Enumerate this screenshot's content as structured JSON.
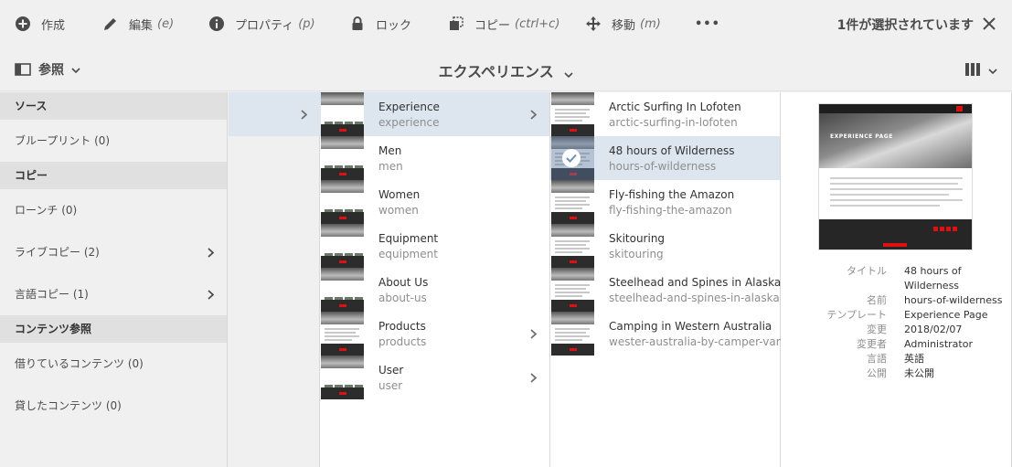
{
  "toolbar": {
    "create_label": "作成",
    "edit_label": "編集",
    "edit_kbd": "(e)",
    "properties_label": "プロパティ",
    "properties_kbd": "(p)",
    "lock_label": "ロック",
    "copy_label": "コピー",
    "copy_kbd": "(ctrl+c)",
    "move_label": "移動",
    "move_kbd": "(m)",
    "more_label": "•••",
    "selection_count": "1件が選択されています"
  },
  "subbar": {
    "reference_label": "参照",
    "breadcrumb": "エクスペリエンス"
  },
  "rail": {
    "sections": [
      {
        "heading": "ソース",
        "items": [
          {
            "label": "ブループリント (0)",
            "has_arrow": false
          }
        ]
      },
      {
        "heading": "コピー",
        "items": [
          {
            "label": "ローンチ (0)",
            "has_arrow": false
          },
          {
            "label": "ライブコピー (2)",
            "has_arrow": true
          },
          {
            "label": "言語コピー (1)",
            "has_arrow": true
          }
        ]
      },
      {
        "heading": "コンテンツ参照",
        "items": [
          {
            "label": "借りているコンテンツ (0)",
            "has_arrow": false
          },
          {
            "label": "貸したコンテンツ (0)",
            "has_arrow": false
          }
        ]
      }
    ]
  },
  "column2": [
    {
      "title": "Experience",
      "name": "experience",
      "has_arrow": true,
      "active": true
    },
    {
      "title": "Men",
      "name": "men",
      "has_arrow": false
    },
    {
      "title": "Women",
      "name": "women",
      "has_arrow": false
    },
    {
      "title": "Equipment",
      "name": "equipment",
      "has_arrow": false
    },
    {
      "title": "About Us",
      "name": "about-us",
      "has_arrow": false
    },
    {
      "title": "Products",
      "name": "products",
      "has_arrow": true
    },
    {
      "title": "User",
      "name": "user",
      "has_arrow": true
    }
  ],
  "column3": [
    {
      "title": "Arctic Surfing In Lofoten",
      "name": "arctic-surfing-in-lofoten",
      "selected": false
    },
    {
      "title": "48 hours of Wilderness",
      "name": "hours-of-wilderness",
      "selected": true
    },
    {
      "title": "Fly-fishing the Amazon",
      "name": "fly-fishing-the-amazon",
      "selected": false
    },
    {
      "title": "Skitouring",
      "name": "skitouring",
      "selected": false
    },
    {
      "title": "Steelhead and Spines in Alaska",
      "name": "steelhead-and-spines-in-alaska",
      "selected": false
    },
    {
      "title": "Camping in Western Australia",
      "name": "wester-australia-by-camper-van",
      "selected": false
    }
  ],
  "preview": {
    "hero_title": "EXPERIENCE PAGE"
  },
  "meta": {
    "title_key": "タイトル",
    "title_val": "48 hours of Wilderness",
    "name_key": "名前",
    "name_val": "hours-of-wilderness",
    "template_key": "テンプレート",
    "template_val": "Experience Page",
    "modified_key": "変更",
    "modified_val": "2018/02/07",
    "modifier_key": "変更者",
    "modifier_val": "Administrator",
    "language_key": "言語",
    "language_val": "英語",
    "published_key": "公開",
    "published_val": "未公開"
  },
  "colors": {
    "accent": "#e01010",
    "active_row": "#dde6ef",
    "text_primary": "#323232",
    "text_secondary": "#8e8e8e"
  }
}
